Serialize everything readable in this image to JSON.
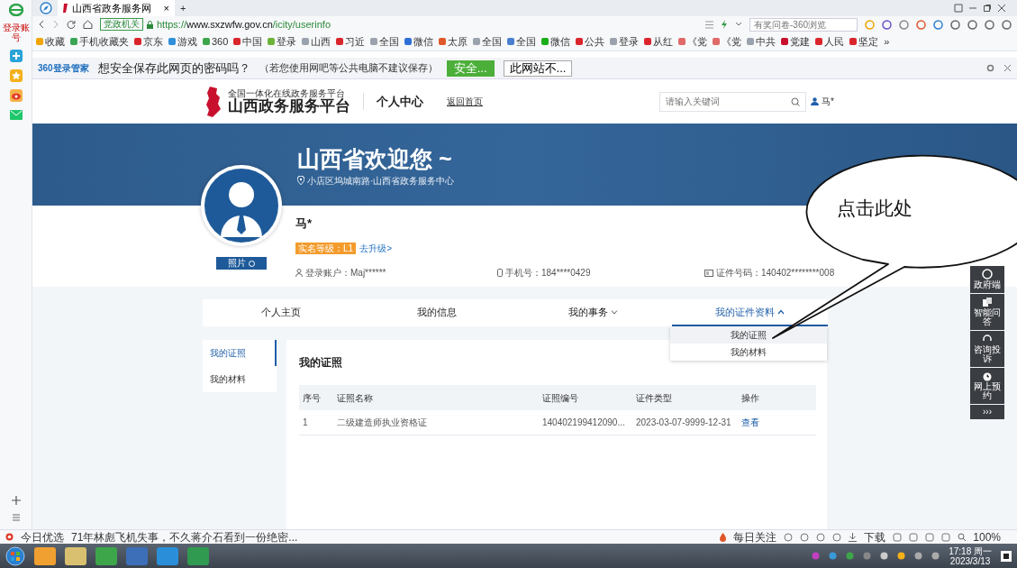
{
  "browser": {
    "logo_label": "登录账号",
    "tabs": [
      {
        "title": "山西省政务服务网",
        "selected": true
      }
    ],
    "close_tab": "×",
    "new_tab": "+",
    "address": {
      "badge": "党政机关",
      "url": "https://**www.sxzwfw.gov.cn**/icity/userinfo",
      "search_placeholder": "有奖问卷-360浏览"
    },
    "bookmarks": [
      {
        "label": "收藏",
        "color": "#f0a500"
      },
      {
        "label": "手机收藏夹",
        "color": "#3aa655"
      },
      {
        "label": "京东",
        "color": "#d9262c"
      },
      {
        "label": "游戏",
        "color": "#2f8fd8"
      },
      {
        "label": "360",
        "color": "#3ea64a"
      },
      {
        "label": "中国",
        "color": "#d9262c"
      },
      {
        "label": "登录",
        "color": "#6bb33a"
      },
      {
        "label": "山西",
        "color": "#9aa3ad"
      },
      {
        "label": "习近",
        "color": "#d9262c"
      },
      {
        "label": "全国",
        "color": "#9aa3ad"
      },
      {
        "label": "微信",
        "color": "#2f6fd8"
      },
      {
        "label": "太原",
        "color": "#e0582a"
      },
      {
        "label": "全国",
        "color": "#9aa3ad"
      },
      {
        "label": "全国",
        "color": "#4a7fd0"
      },
      {
        "label": "微信",
        "color": "#1aad19"
      },
      {
        "label": "公共",
        "color": "#d9262c"
      },
      {
        "label": "登录",
        "color": "#9aa3ad"
      },
      {
        "label": "从红",
        "color": "#d9262c"
      },
      {
        "label": "《党",
        "color": "#e06a6a"
      },
      {
        "label": "《党",
        "color": "#e06a6a"
      },
      {
        "label": "中共",
        "color": "#9aa3ad"
      },
      {
        "label": "党建",
        "color": "#c8102e"
      },
      {
        "label": "人民",
        "color": "#d9262c"
      },
      {
        "label": "坚定",
        "color": "#d9262c"
      }
    ],
    "bookmarks_more": "»",
    "password_bar": {
      "brand": "360登录管家",
      "question": "想安全保存此网页的密码吗？",
      "hint": "（若您使用网吧等公共电脑不建议保存）",
      "save": "安全...",
      "never": "此网站不..."
    }
  },
  "page": {
    "header": {
      "subtitle": "全国一体化在线政务服务平台",
      "title": "山西政务服务平台",
      "section": "个人中心",
      "home_link": "返回首页",
      "search_placeholder": "请输入关键词",
      "user": "马*"
    },
    "banner": {
      "greeting": "山西省欢迎您 ~",
      "address": "小店区坞城南路·山西省政务服务中心"
    },
    "profile": {
      "photo_button": "照片",
      "name": "马*",
      "level_badge": "实名等级：L1",
      "upgrade": "去升级>",
      "account": "登录账户：Maj******",
      "phone": "手机号：184****0429",
      "id_number": "证件号码：140402********008"
    },
    "nav": [
      {
        "label": "个人主页",
        "selected": false
      },
      {
        "label": "我的信息",
        "selected": false
      },
      {
        "label": "我的事务",
        "selected": false,
        "expanded": false
      },
      {
        "label": "我的证件资料",
        "selected": true,
        "expanded": true
      }
    ],
    "dropdown": [
      {
        "label": "我的证照",
        "selected": true
      },
      {
        "label": "我的材料",
        "selected": false
      }
    ],
    "side_menu": [
      {
        "label": "我的证照",
        "selected": true
      },
      {
        "label": "我的材料",
        "selected": false
      }
    ],
    "content_title": "我的证照",
    "table": {
      "columns": [
        "序号",
        "证照名称",
        "证照编号",
        "证件类型",
        "操作"
      ],
      "rows": [
        [
          "1",
          "二级建造师执业资格证",
          "140402199412090...",
          "2023-03-07-9999-12-31",
          "查看"
        ]
      ]
    },
    "float_toolbar": [
      "政府端",
      "智能问答",
      "咨询投诉",
      "网上预约",
      "›››"
    ],
    "callout": "点击此处"
  },
  "status_bar": {
    "news_source": "今日优选",
    "headline": "71年林彪飞机失事，不久蒋介石看到一份绝密...",
    "daily": "每日关注",
    "download": "下载",
    "zoom": "100%"
  },
  "taskbar": {
    "time": "17:18 周一",
    "date": "2023/3/13"
  }
}
